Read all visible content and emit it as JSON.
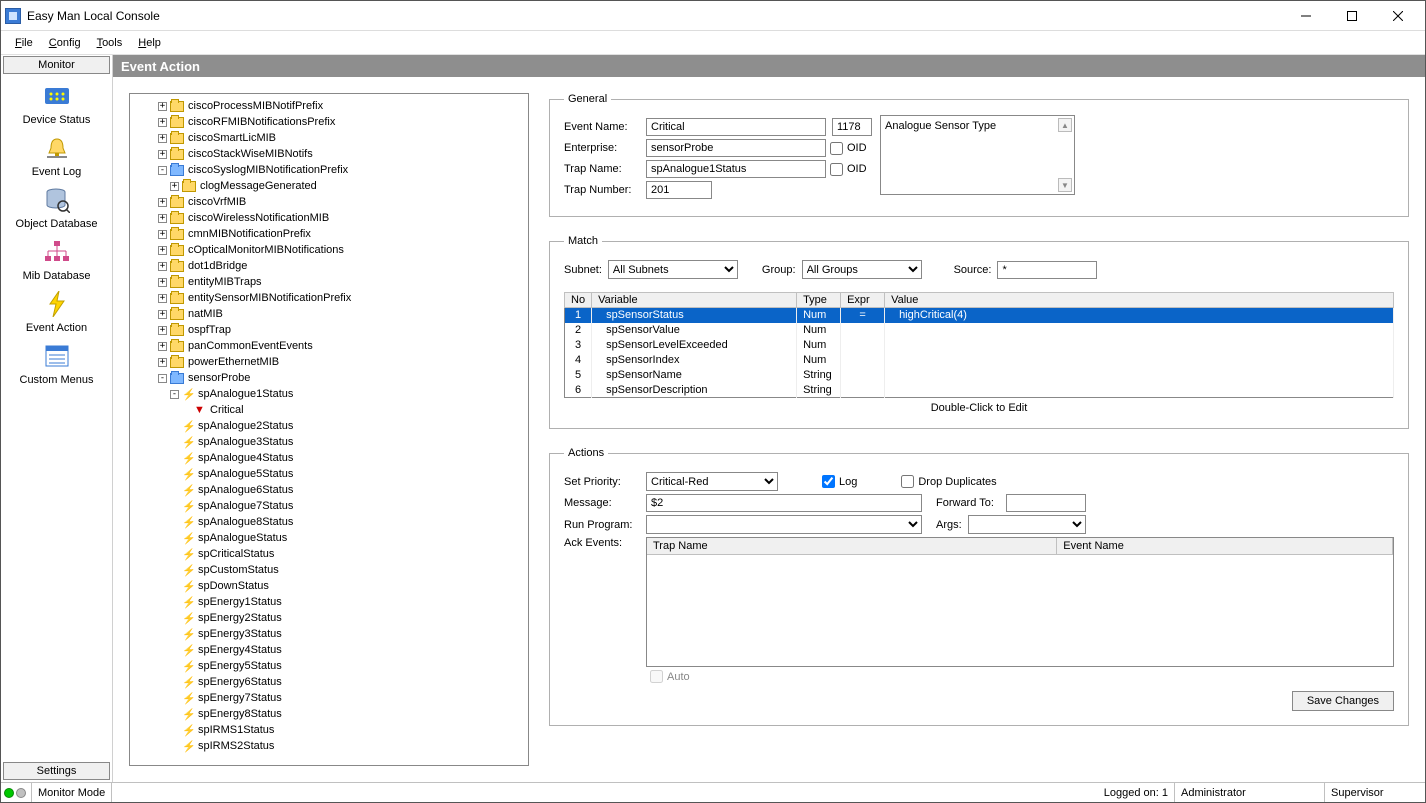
{
  "title": "Easy Man Local Console",
  "menu": {
    "file": "File",
    "config": "Config",
    "tools": "Tools",
    "help": "Help"
  },
  "sidebar": {
    "monitor_tab": "Monitor",
    "settings_tab": "Settings",
    "items": [
      {
        "label": "Device Status"
      },
      {
        "label": "Event Log"
      },
      {
        "label": "Object Database"
      },
      {
        "label": "Mib Database"
      },
      {
        "label": "Event Action"
      },
      {
        "label": "Custom Menus"
      }
    ]
  },
  "page_title": "Event Action",
  "tree": {
    "top": [
      "ciscoProcessMIBNotifPrefix",
      "ciscoRFMIBNotificationsPrefix",
      "ciscoSmartLicMIB",
      "ciscoStackWiseMIBNotifs"
    ],
    "syslog": "ciscoSyslogMIBNotificationPrefix",
    "syslog_child": "clogMessageGenerated",
    "mid": [
      "ciscoVrfMIB",
      "ciscoWirelessNotificationMIB",
      "cmnMIBNotificationPrefix",
      "cOpticalMonitorMIBNotifications",
      "dot1dBridge",
      "entityMIBTraps",
      "entitySensorMIBNotificationPrefix",
      "natMIB",
      "ospfTrap",
      "panCommonEventEvents",
      "powerEthernetMIB"
    ],
    "sensorprobe": "sensorProbe",
    "sp_analogue1": "spAnalogue1Status",
    "critical": "Critical",
    "sp_rest": [
      "spAnalogue2Status",
      "spAnalogue3Status",
      "spAnalogue4Status",
      "spAnalogue5Status",
      "spAnalogue6Status",
      "spAnalogue7Status",
      "spAnalogue8Status",
      "spAnalogueStatus",
      "spCriticalStatus",
      "spCustomStatus",
      "spDownStatus",
      "spEnergy1Status",
      "spEnergy2Status",
      "spEnergy3Status",
      "spEnergy4Status",
      "spEnergy5Status",
      "spEnergy6Status",
      "spEnergy7Status",
      "spEnergy8Status",
      "spIRMS1Status",
      "spIRMS2Status"
    ]
  },
  "general": {
    "legend": "General",
    "event_name_label": "Event Name:",
    "event_name": "Critical",
    "event_id": "1178",
    "enterprise_label": "Enterprise:",
    "enterprise": "sensorProbe",
    "oid_label": "OID",
    "trap_name_label": "Trap Name:",
    "trap_name": "spAnalogue1Status",
    "trap_number_label": "Trap Number:",
    "trap_number": "201",
    "desc": "Analogue Sensor Type"
  },
  "match": {
    "legend": "Match",
    "subnet_label": "Subnet:",
    "subnet": "All Subnets",
    "group_label": "Group:",
    "group": "All Groups",
    "source_label": "Source:",
    "source": "*",
    "cols": {
      "no": "No",
      "variable": "Variable",
      "type": "Type",
      "expr": "Expr",
      "value": "Value"
    },
    "rows": [
      {
        "no": "1",
        "variable": "spSensorStatus",
        "type": "Num",
        "expr": "=",
        "value": "highCritical(4)",
        "selected": true
      },
      {
        "no": "2",
        "variable": "spSensorValue",
        "type": "Num",
        "expr": "",
        "value": ""
      },
      {
        "no": "3",
        "variable": "spSensorLevelExceeded",
        "type": "Num",
        "expr": "",
        "value": ""
      },
      {
        "no": "4",
        "variable": "spSensorIndex",
        "type": "Num",
        "expr": "",
        "value": ""
      },
      {
        "no": "5",
        "variable": "spSensorName",
        "type": "String",
        "expr": "",
        "value": ""
      },
      {
        "no": "6",
        "variable": "spSensorDescription",
        "type": "String",
        "expr": "",
        "value": ""
      }
    ],
    "hint": "Double-Click to Edit"
  },
  "actions": {
    "legend": "Actions",
    "priority_label": "Set Priority:",
    "priority": "Critical-Red",
    "log_label": "Log",
    "drop_label": "Drop Duplicates",
    "message_label": "Message:",
    "message": "$2",
    "forward_label": "Forward To:",
    "forward": "",
    "run_label": "Run Program:",
    "args_label": "Args:",
    "ack_label": "Ack Events:",
    "ack_cols": {
      "trap": "Trap Name",
      "event": "Event Name"
    },
    "auto_label": "Auto",
    "save": "Save Changes"
  },
  "status": {
    "mode": "Monitor Mode",
    "logged": "Logged on: 1",
    "user": "Administrator",
    "role": "Supervisor"
  }
}
